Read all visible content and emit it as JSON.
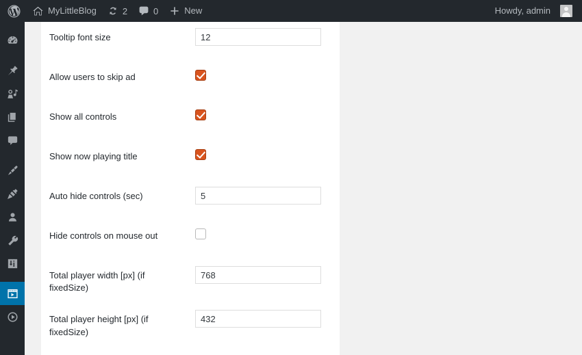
{
  "adminbar": {
    "wp_logo_icon": "wordpress-logo-icon",
    "site_home_icon": "home-icon",
    "site_name": "MyLittleBlog",
    "updates_icon": "updates-icon",
    "updates_count": "2",
    "comments_icon": "comment-bubble-icon",
    "comments_count": "0",
    "new_icon": "plus-icon",
    "new_label": "New",
    "howdy": "Howdy, admin",
    "avatar_icon": "avatar-icon"
  },
  "sidebar": {
    "items": [
      {
        "name": "dashboard",
        "icon": "dashboard-gauge-icon",
        "current": false
      },
      {
        "name": "posts",
        "icon": "pushpin-icon",
        "current": false
      },
      {
        "name": "media",
        "icon": "media-music-icon",
        "current": false
      },
      {
        "name": "pages",
        "icon": "pages-icon",
        "current": false
      },
      {
        "name": "comments",
        "icon": "comment-bubble-icon",
        "current": false
      },
      {
        "name": "appearance",
        "icon": "paintbrush-icon",
        "current": false
      },
      {
        "name": "plugins",
        "icon": "plug-icon",
        "current": false
      },
      {
        "name": "users",
        "icon": "user-icon",
        "current": false
      },
      {
        "name": "tools",
        "icon": "wrench-icon",
        "current": false
      },
      {
        "name": "settings",
        "icon": "sliders-icon",
        "current": false
      },
      {
        "name": "video-player",
        "icon": "video-player-icon",
        "current": true
      },
      {
        "name": "media-player",
        "icon": "play-circle-icon",
        "current": false
      }
    ]
  },
  "settings_form": {
    "rows": [
      {
        "label": "Tooltip font size",
        "type": "text",
        "value": "12",
        "field_name": "tooltip-font-size"
      },
      {
        "label": "Allow users to skip ad",
        "type": "checkbox",
        "checked": true,
        "field_name": "allow-skip-ad"
      },
      {
        "label": "Show all controls",
        "type": "checkbox",
        "checked": true,
        "field_name": "show-all-controls"
      },
      {
        "label": "Show now playing title",
        "type": "checkbox",
        "checked": true,
        "field_name": "show-now-playing-title"
      },
      {
        "label": "Auto hide controls (sec)",
        "type": "text",
        "value": "5",
        "field_name": "auto-hide-controls"
      },
      {
        "label": "Hide controls on mouse out",
        "type": "checkbox",
        "checked": false,
        "field_name": "hide-controls-on-mouse-out"
      },
      {
        "label": "Total player width [px] (if fixedSize)",
        "type": "text",
        "value": "768",
        "field_name": "total-player-width"
      },
      {
        "label": "Total player height [px] (if fixedSize)",
        "type": "text",
        "value": "432",
        "field_name": "total-player-height"
      }
    ]
  },
  "colors": {
    "adminbar_bg": "#23282d",
    "sidebar_bg": "#23282d",
    "current_menu": "#0073aa",
    "checkbox_checked": "#d9541e",
    "page_bg": "#f1f1f1",
    "panel_bg": "#ffffff"
  }
}
